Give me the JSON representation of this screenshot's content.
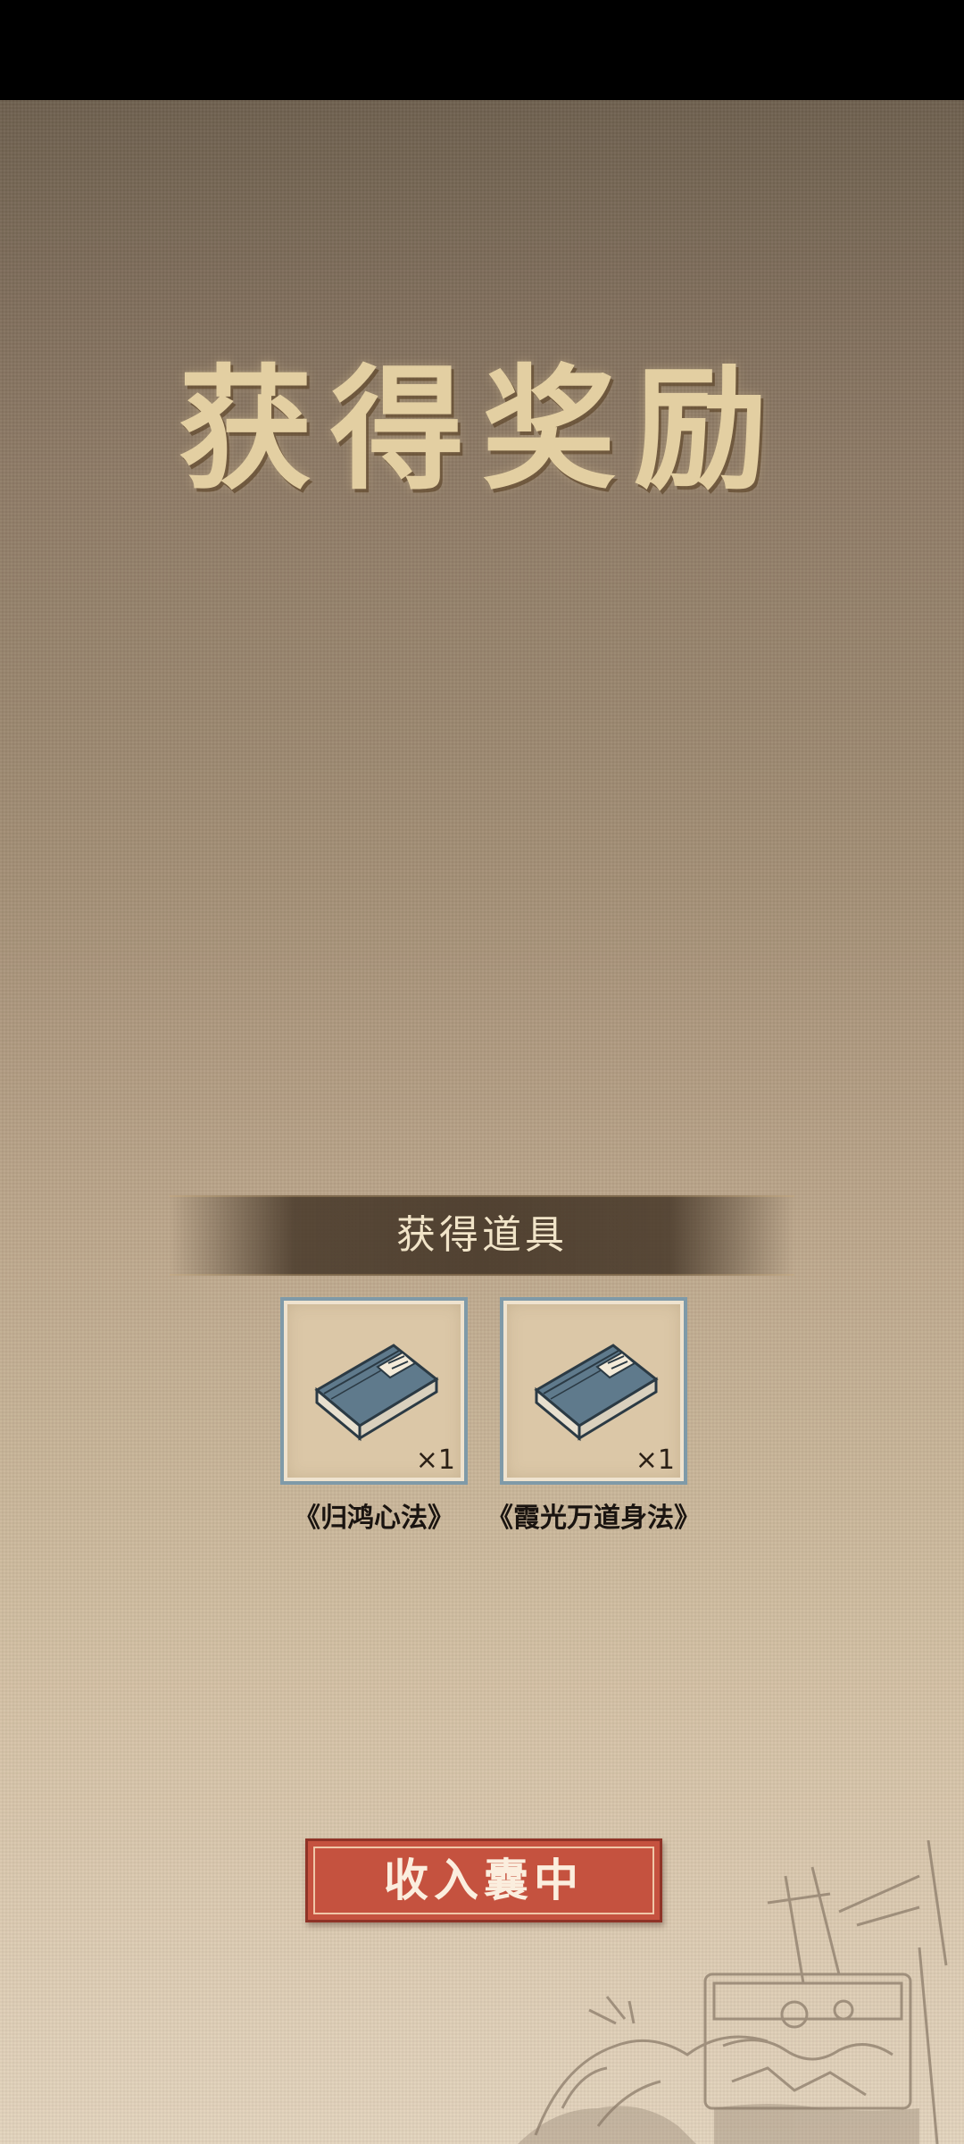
{
  "title": "获得奖励",
  "section": {
    "label": "获得道具"
  },
  "items": [
    {
      "name": "《归鸿心法》",
      "quantity": "×1",
      "icon": "manual-book-icon"
    },
    {
      "name": "《霞光万道身法》",
      "quantity": "×1",
      "icon": "manual-book-icon"
    }
  ],
  "button": {
    "label": "收入囊中"
  },
  "colors": {
    "title": "#e3cfa2",
    "button": "#c5523f",
    "card_border": "#7f9aa8",
    "book_cover": "#5f7a8c"
  }
}
